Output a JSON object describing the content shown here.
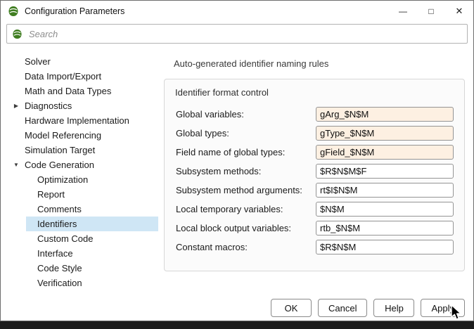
{
  "window": {
    "title": "Configuration Parameters",
    "controls": {
      "minimize": "—",
      "maximize": "□",
      "close": "✕"
    }
  },
  "search": {
    "placeholder": "Search"
  },
  "icons": {
    "collapsed_arrow": "▶",
    "expanded_arrow": "▼"
  },
  "sidebar": {
    "items": [
      {
        "label": "Solver"
      },
      {
        "label": "Data Import/Export"
      },
      {
        "label": "Math and Data Types"
      },
      {
        "label": "Diagnostics",
        "state": "collapsed"
      },
      {
        "label": "Hardware Implementation"
      },
      {
        "label": "Model Referencing"
      },
      {
        "label": "Simulation Target"
      },
      {
        "label": "Code Generation",
        "state": "expanded"
      },
      {
        "label": "Optimization"
      },
      {
        "label": "Report"
      },
      {
        "label": "Comments"
      },
      {
        "label": "Identifiers",
        "selected": true
      },
      {
        "label": "Custom Code"
      },
      {
        "label": "Interface"
      },
      {
        "label": "Code Style"
      },
      {
        "label": "Verification"
      }
    ]
  },
  "main": {
    "heading": "Auto-generated identifier naming rules",
    "group_title": "Identifier format control",
    "fields": [
      {
        "label": "Global variables:",
        "value": "gArg_$N$M",
        "highlighted": true
      },
      {
        "label": "Global types:",
        "value": "gType_$N$M",
        "highlighted": true
      },
      {
        "label": "Field name of global types:",
        "value": "gField_$N$M",
        "highlighted": true
      },
      {
        "label": "Subsystem methods:",
        "value": "$R$N$M$F",
        "highlighted": false
      },
      {
        "label": "Subsystem method arguments:",
        "value": "rt$I$N$M",
        "highlighted": false
      },
      {
        "label": "Local temporary variables:",
        "value": "$N$M",
        "highlighted": false
      },
      {
        "label": "Local block output variables:",
        "value": "rtb_$N$M",
        "highlighted": false
      },
      {
        "label": "Constant macros:",
        "value": "$R$N$M",
        "highlighted": false
      }
    ]
  },
  "footer": {
    "buttons": [
      "OK",
      "Cancel",
      "Help",
      "Apply"
    ]
  },
  "colors": {
    "selected_item_bg": "#cfe6f5",
    "modified_field_bg": "#fdf0e2",
    "brand_green": "#3f7d20"
  }
}
